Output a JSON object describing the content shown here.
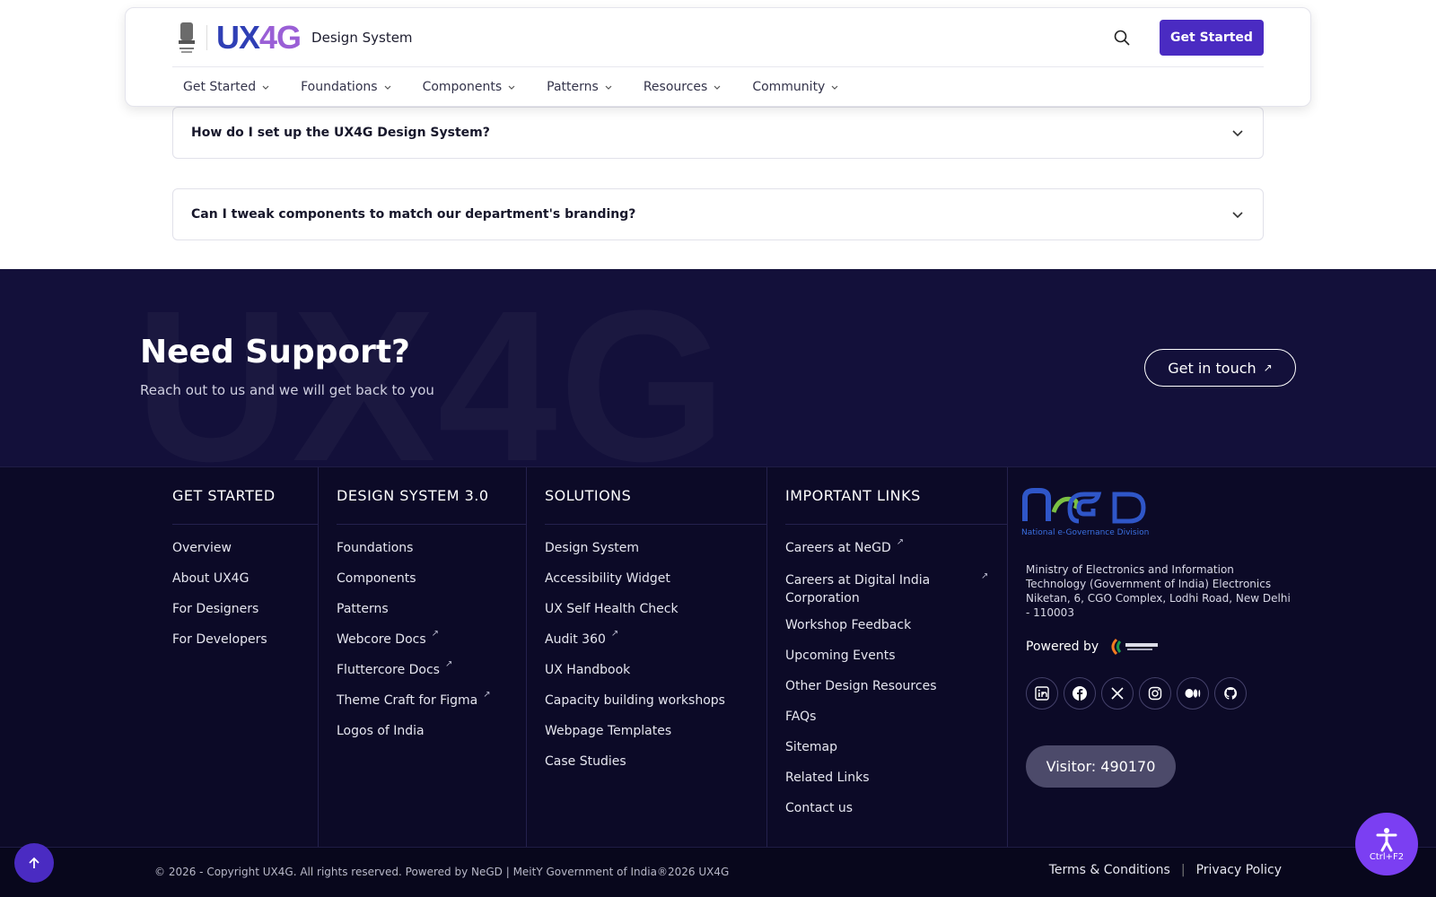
{
  "header": {
    "logo_ux": "UX",
    "logo_4g": "4G",
    "logo_subtitle": "Design System",
    "cta_label": "Get Started",
    "nav": [
      {
        "label": "Get Started"
      },
      {
        "label": "Foundations"
      },
      {
        "label": "Components"
      },
      {
        "label": "Patterns"
      },
      {
        "label": "Resources"
      },
      {
        "label": "Community"
      }
    ]
  },
  "faq": [
    {
      "question": "How do I set up the UX4G Design System?"
    },
    {
      "question": "Can I tweak components to match our department's branding?"
    }
  ],
  "support": {
    "watermark": "UX4G",
    "title": "Need Support?",
    "subtitle": "Reach out to us and we will get back to you",
    "button": "Get in touch"
  },
  "footer": {
    "columns": [
      {
        "title": "GET STARTED",
        "links": [
          "Overview",
          "About UX4G",
          "For Designers",
          "For Developers"
        ]
      },
      {
        "title": "DESIGN SYSTEM 3.0",
        "links": [
          "Foundations",
          "Components",
          "Patterns",
          "Webcore Docs",
          "Fluttercore Docs",
          "Theme Craft for Figma",
          "Logos of India"
        ]
      },
      {
        "title": "SOLUTIONS",
        "links": [
          "Design System",
          "Accessibility Widget",
          "UX Self Health Check",
          "Audit 360",
          "UX Handbook",
          "Capacity building workshops",
          "Webpage Templates",
          "Case Studies"
        ]
      },
      {
        "title": "IMPORTANT LINKS",
        "links": [
          "Careers at NeGD",
          "Careers at Digital India Corporation",
          "Workshop Feedback",
          "Upcoming Events",
          "Other Design Resources",
          "FAQs",
          "Sitemap",
          "Related Links",
          "Contact us"
        ]
      }
    ],
    "negd_tagline": "National e-Governance Division",
    "ministry_address": "Ministry of Electronics and Information Technology (Government of India) Electronics Niketan, 6, CGO Complex, Lodhi Road, New Delhi - 110003",
    "powered_by": "Powered by",
    "socials": [
      "linkedin-icon",
      "facebook-icon",
      "x-icon",
      "instagram-icon",
      "medium-icon",
      "github-icon"
    ],
    "visitor_label": "Visitor:",
    "visitor_count": "490170"
  },
  "bottom": {
    "copyright": "© 2026 - Copyright UX4G. All rights reserved. Powered by NeGD | MeitY Government of India®2026 UX4G",
    "terms": "Terms & Conditions",
    "privacy": "Privacy Policy"
  },
  "a11y": {
    "shortcut": "Ctrl+F2"
  },
  "colors": {
    "primary": "#4a2bc2",
    "banner": "#13103a",
    "footer": "#0c0a27"
  }
}
